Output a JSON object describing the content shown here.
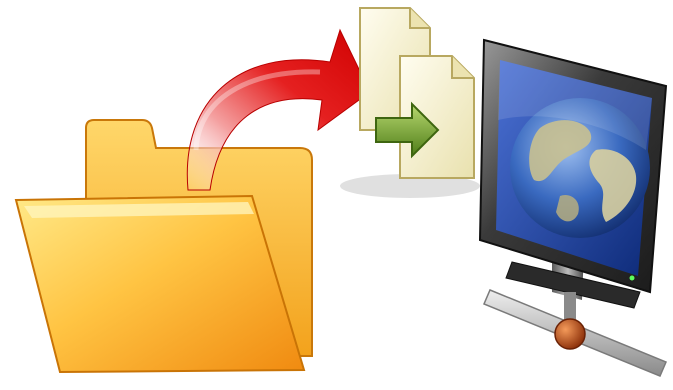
{
  "scene": {
    "icons": [
      {
        "role": "source",
        "icon": "folder-icon"
      },
      {
        "role": "transfer",
        "icon": "curved-arrow-icon"
      },
      {
        "role": "payload",
        "icon": "documents-icon"
      },
      {
        "role": "destination",
        "icon": "network-computer-icon"
      }
    ],
    "colors": {
      "folder_body": "#f5a623",
      "folder_highlight": "#ffe680",
      "arrow": "#e01010",
      "documents": "#f7f0c8",
      "document_arrow": "#6a9a2a",
      "monitor_frame": "#3c3c3c",
      "screen": "#1f3f8f",
      "globe_land": "#c8c090",
      "globe_sea": "#2a5ab0",
      "network_cable": "#9a9a9a",
      "network_node": "#b04a10"
    }
  }
}
